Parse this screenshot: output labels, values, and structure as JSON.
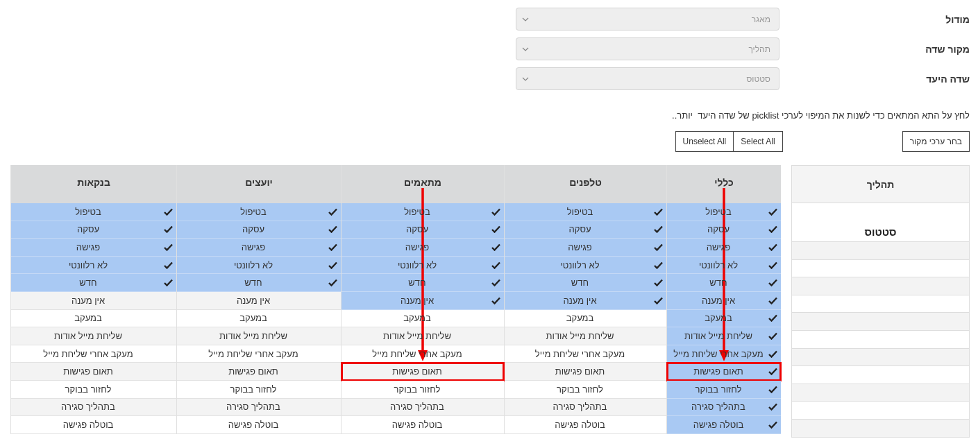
{
  "form": {
    "fields": [
      {
        "label": "מודול",
        "value": "מאגר"
      },
      {
        "label": "מקור שדה",
        "value": "תהליך"
      },
      {
        "label": "שדה היעד",
        "value": "סטטוס"
      }
    ]
  },
  "instruction": "לחץ על התא המתאים כדי לשנות את המיפוי לערכי picklist של שדה היעד  יותר..",
  "buttons": {
    "choose_source": "בחר ערכי מקור",
    "select_all": "Select All",
    "unselect_all": "Unselect All"
  },
  "source_table": {
    "header": "תהליך",
    "value": "סטטוס"
  },
  "mapping_table": {
    "columns": [
      {
        "title": "כללי",
        "arrow": true,
        "cells": [
          {
            "text": "בטיפול",
            "selected": true,
            "highlighted": false
          },
          {
            "text": "עסקה",
            "selected": true,
            "highlighted": false
          },
          {
            "text": "פגישה",
            "selected": true,
            "highlighted": false
          },
          {
            "text": "לא רלוונטי",
            "selected": true,
            "highlighted": false
          },
          {
            "text": "חדש",
            "selected": true,
            "highlighted": false
          },
          {
            "text": "אין מענה",
            "selected": true,
            "highlighted": false
          },
          {
            "text": "במעקב",
            "selected": true,
            "highlighted": false
          },
          {
            "text": "שליחת מייל אודות",
            "selected": true,
            "highlighted": false
          },
          {
            "text": "מעקב אחרי שליחת מייל",
            "selected": true,
            "highlighted": false
          },
          {
            "text": "תאום פגישות",
            "selected": true,
            "highlighted": true
          },
          {
            "text": "לחזור בבוקר",
            "selected": true,
            "highlighted": false
          },
          {
            "text": "בתהליך סגירה",
            "selected": true,
            "highlighted": false
          },
          {
            "text": "בוטלה פגישה",
            "selected": true,
            "highlighted": false
          }
        ]
      },
      {
        "title": "טלפנים",
        "arrow": false,
        "cells": [
          {
            "text": "בטיפול",
            "selected": true,
            "highlighted": false
          },
          {
            "text": "עסקה",
            "selected": true,
            "highlighted": false
          },
          {
            "text": "פגישה",
            "selected": true,
            "highlighted": false
          },
          {
            "text": "לא רלוונטי",
            "selected": true,
            "highlighted": false
          },
          {
            "text": "חדש",
            "selected": true,
            "highlighted": false
          },
          {
            "text": "אין מענה",
            "selected": true,
            "highlighted": false
          },
          {
            "text": "במעקב",
            "selected": false,
            "highlighted": false
          },
          {
            "text": "שליחת מייל אודות",
            "selected": false,
            "highlighted": false
          },
          {
            "text": "מעקב אחרי שליחת מייל",
            "selected": false,
            "highlighted": false
          },
          {
            "text": "תאום פגישות",
            "selected": false,
            "highlighted": false
          },
          {
            "text": "לחזור בבוקר",
            "selected": false,
            "highlighted": false
          },
          {
            "text": "בתהליך סגירה",
            "selected": false,
            "highlighted": false
          },
          {
            "text": "בוטלה פגישה",
            "selected": false,
            "highlighted": false
          }
        ]
      },
      {
        "title": "מתאמים",
        "arrow": true,
        "cells": [
          {
            "text": "בטיפול",
            "selected": true,
            "highlighted": false
          },
          {
            "text": "עסקה",
            "selected": true,
            "highlighted": false
          },
          {
            "text": "פגישה",
            "selected": true,
            "highlighted": false
          },
          {
            "text": "לא רלוונטי",
            "selected": true,
            "highlighted": false
          },
          {
            "text": "חדש",
            "selected": true,
            "highlighted": false
          },
          {
            "text": "אין מענה",
            "selected": true,
            "highlighted": false
          },
          {
            "text": "במעקב",
            "selected": false,
            "highlighted": false
          },
          {
            "text": "שליחת מייל אודות",
            "selected": false,
            "highlighted": false
          },
          {
            "text": "מעקב אחרי שליחת מייל",
            "selected": false,
            "highlighted": false
          },
          {
            "text": "תאום פגישות",
            "selected": false,
            "highlighted": true
          },
          {
            "text": "לחזור בבוקר",
            "selected": false,
            "highlighted": false
          },
          {
            "text": "בתהליך סגירה",
            "selected": false,
            "highlighted": false
          },
          {
            "text": "בוטלה פגישה",
            "selected": false,
            "highlighted": false
          }
        ]
      },
      {
        "title": "יועצים",
        "arrow": false,
        "cells": [
          {
            "text": "בטיפול",
            "selected": true,
            "highlighted": false
          },
          {
            "text": "עסקה",
            "selected": true,
            "highlighted": false
          },
          {
            "text": "פגישה",
            "selected": true,
            "highlighted": false
          },
          {
            "text": "לא רלוונטי",
            "selected": true,
            "highlighted": false
          },
          {
            "text": "חדש",
            "selected": true,
            "highlighted": false
          },
          {
            "text": "אין מענה",
            "selected": false,
            "highlighted": false
          },
          {
            "text": "במעקב",
            "selected": false,
            "highlighted": false
          },
          {
            "text": "שליחת מייל אודות",
            "selected": false,
            "highlighted": false
          },
          {
            "text": "מעקב אחרי שליחת מייל",
            "selected": false,
            "highlighted": false
          },
          {
            "text": "תאום פגישות",
            "selected": false,
            "highlighted": false
          },
          {
            "text": "לחזור בבוקר",
            "selected": false,
            "highlighted": false
          },
          {
            "text": "בתהליך סגירה",
            "selected": false,
            "highlighted": false
          },
          {
            "text": "בוטלה פגישה",
            "selected": false,
            "highlighted": false
          }
        ]
      },
      {
        "title": "בנקאות",
        "arrow": false,
        "cells": [
          {
            "text": "בטיפול",
            "selected": true,
            "highlighted": false
          },
          {
            "text": "עסקה",
            "selected": true,
            "highlighted": false
          },
          {
            "text": "פגישה",
            "selected": true,
            "highlighted": false
          },
          {
            "text": "לא רלוונטי",
            "selected": true,
            "highlighted": false
          },
          {
            "text": "חדש",
            "selected": true,
            "highlighted": false
          },
          {
            "text": "אין מענה",
            "selected": false,
            "highlighted": false
          },
          {
            "text": "במעקב",
            "selected": false,
            "highlighted": false
          },
          {
            "text": "שליחת מייל אודות",
            "selected": false,
            "highlighted": false
          },
          {
            "text": "מעקב אחרי שליחת מייל",
            "selected": false,
            "highlighted": false
          },
          {
            "text": "תאום פגישות",
            "selected": false,
            "highlighted": false
          },
          {
            "text": "לחזור בבוקר",
            "selected": false,
            "highlighted": false
          },
          {
            "text": "בתהליך סגירה",
            "selected": false,
            "highlighted": false
          },
          {
            "text": "בוטלה פגישה",
            "selected": false,
            "highlighted": false
          }
        ]
      }
    ]
  }
}
